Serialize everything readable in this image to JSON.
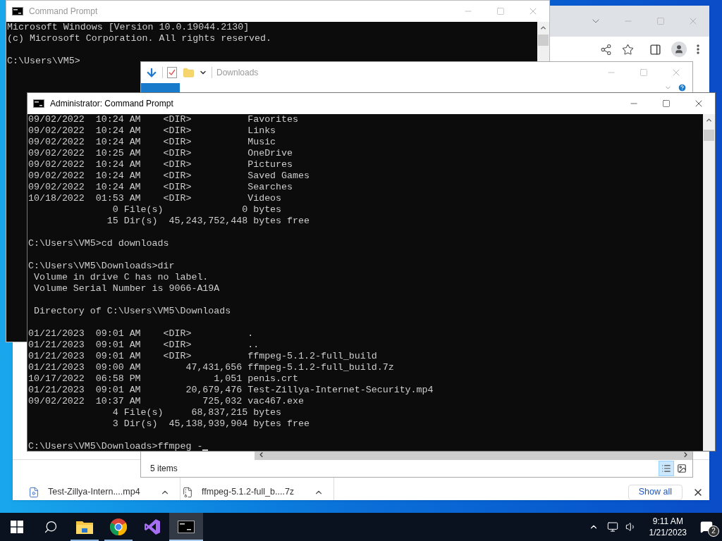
{
  "browser": {
    "downloads": [
      {
        "name": "Test-Zillya-Intern....mp4",
        "kind": "video"
      },
      {
        "name": "ffmpeg-5.1.2-full_b....7z",
        "kind": "archive"
      }
    ],
    "show_all": "Show all"
  },
  "console_back": {
    "title": "Command Prompt",
    "active": false,
    "blocks": [
      [
        "Microsoft Windows [Version 10.0.19044.2130]",
        "(c) Microsoft Corporation. All rights reserved."
      ],
      [
        "C:\\Users\\VM5>"
      ]
    ]
  },
  "explorer": {
    "title": "Downloads",
    "status": "5 items",
    "views": [
      {
        "kind": "details",
        "selected": true
      },
      {
        "kind": "tiles",
        "selected": false
      }
    ]
  },
  "console_front": {
    "title": "Administrator: Command Prompt",
    "active": true,
    "blocks": [
      [
        "09/02/2022  10:24 AM    <DIR>          Favorites",
        "09/02/2022  10:24 AM    <DIR>          Links",
        "09/02/2022  10:24 AM    <DIR>          Music",
        "09/02/2022  10:25 AM    <DIR>          OneDrive",
        "09/02/2022  10:24 AM    <DIR>          Pictures",
        "09/02/2022  10:24 AM    <DIR>          Saved Games",
        "09/02/2022  10:24 AM    <DIR>          Searches",
        "10/18/2022  01:53 AM    <DIR>          Videos",
        "               0 File(s)              0 bytes",
        "              15 Dir(s)  45,243,752,448 bytes free"
      ],
      [
        "C:\\Users\\VM5>cd downloads"
      ],
      [
        "C:\\Users\\VM5\\Downloads>dir",
        " Volume in drive C has no label.",
        " Volume Serial Number is 9066-A19A"
      ],
      [
        " Directory of C:\\Users\\VM5\\Downloads"
      ],
      [
        "01/21/2023  09:01 AM    <DIR>          .",
        "01/21/2023  09:01 AM    <DIR>          ..",
        "01/21/2023  09:01 AM    <DIR>          ffmpeg-5.1.2-full_build",
        "01/21/2023  09:00 AM        47,431,656 ffmpeg-5.1.2-full_build.7z",
        "10/17/2022  06:58 PM             1,051 penis.crt",
        "01/21/2023  09:01 AM        20,679,476 Test-Zillya-Internet-Security.mp4",
        "09/02/2022  10:37 AM           725,032 vac467.exe",
        "               4 File(s)     68,837,215 bytes",
        "               3 Dir(s)  45,138,939,904 bytes free"
      ],
      [
        "C:\\Users\\VM5\\Downloads>ffmpeg -"
      ]
    ],
    "cursor": true
  },
  "taskbar": {
    "apps": [
      {
        "kind": "windows"
      },
      {
        "kind": "search"
      },
      {
        "kind": "explorer",
        "running": true,
        "active": false
      },
      {
        "kind": "chrome",
        "running": true,
        "active": false
      },
      {
        "kind": "studio",
        "running": false,
        "active": false
      },
      {
        "kind": "console",
        "running": true,
        "active": true
      }
    ],
    "time": "9:11 AM",
    "date": "1/21/2023",
    "notifications": "2"
  }
}
